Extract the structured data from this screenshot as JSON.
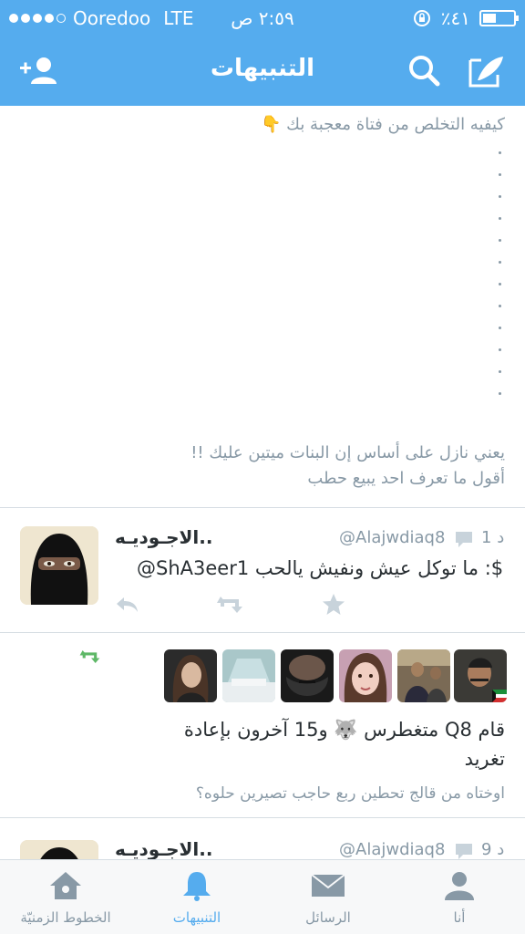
{
  "status_bar": {
    "carrier": "Ooredoo",
    "network": "LTE",
    "time": "٢:٥٩ ص",
    "battery": "٪٤١"
  },
  "nav": {
    "title": "التنبيهات",
    "add_user_icon": "add-user-icon",
    "search_icon": "search-icon",
    "compose_icon": "compose-icon"
  },
  "tweet1": {
    "top_line": "كيفيه التخلص من فتاة معجبة بك 👇",
    "line2": "يعني نازل على أساس إن البنات ميتين عليك !!",
    "line3": "أقول ما تعرف احد يبيع حطب"
  },
  "tweet2": {
    "time": "1 د",
    "handle": "@Alajwdiaq8",
    "name": "الاجـوديـه..",
    "text": "@ShA3eer1 ما توكل عيش ونفيش يالحب :$"
  },
  "retweet_notice": {
    "line1": "قام Q8 متغطرس 🐺 و15 آخرون بإعادة",
    "line2": "تغريد",
    "quote": "اوختاه من قالج تحطين ربع حاجب تصيرين حلوه؟"
  },
  "tweet3": {
    "time": "9 د",
    "handle": "@Alajwdiaq8",
    "name": "الاجـوديـه.."
  },
  "tabs": [
    {
      "label": "الخطوط الزمنيّة",
      "icon": "home-icon"
    },
    {
      "label": "التنبيهات",
      "icon": "bell-icon"
    },
    {
      "label": "الرسائل",
      "icon": "envelope-icon"
    },
    {
      "label": "أنا",
      "icon": "person-icon"
    }
  ],
  "colors": {
    "brand_blue": "#55acee",
    "text_gray": "#8899a6",
    "retweet_green": "#5eb867"
  }
}
